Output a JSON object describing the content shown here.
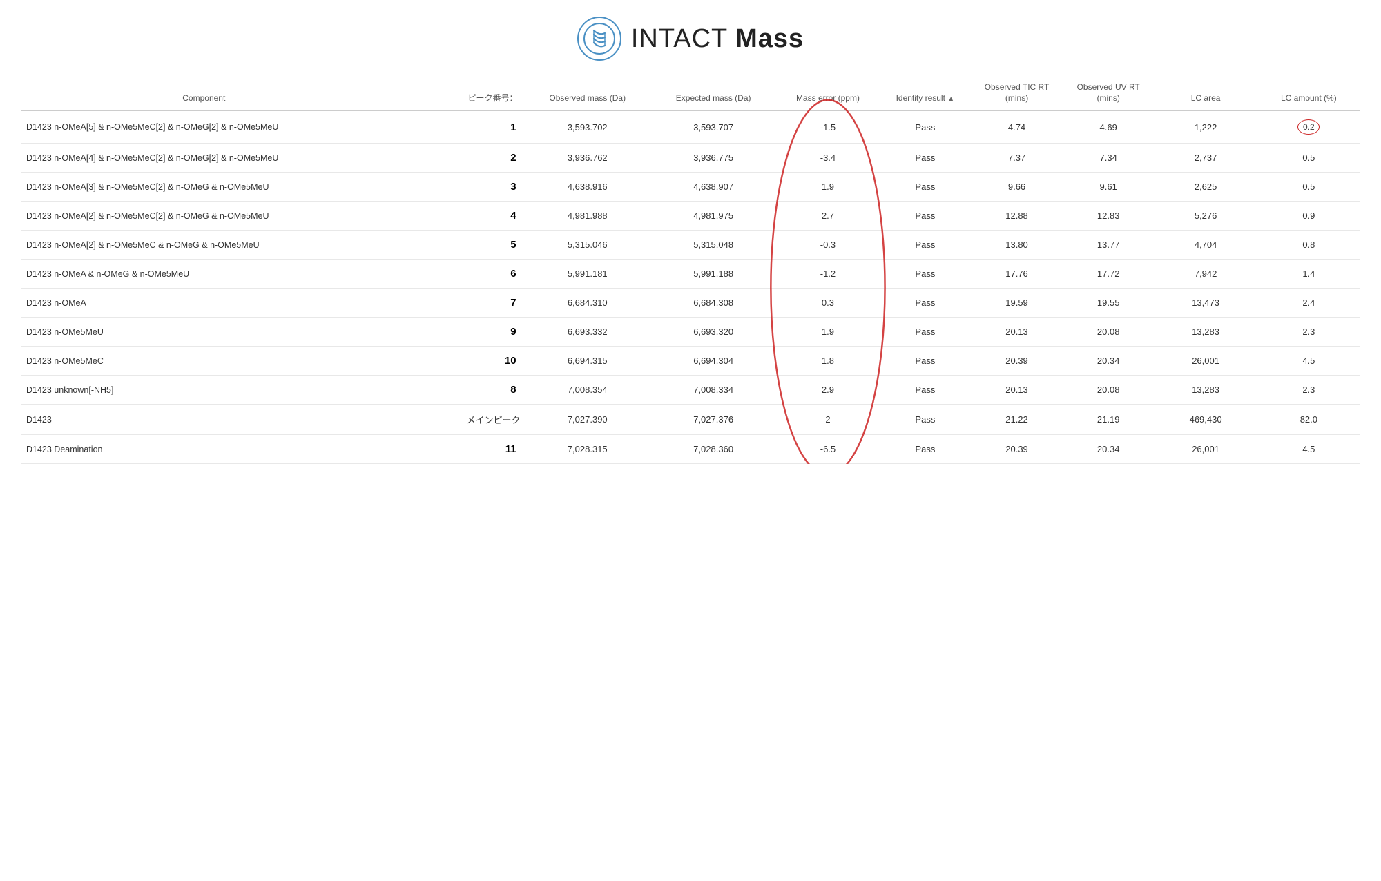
{
  "app": {
    "title_normal": "INTACT ",
    "title_bold": "Mass"
  },
  "table": {
    "headers": {
      "component": "Component",
      "peak_number": "ピーク番号：",
      "observed_mass": "Observed mass (Da)",
      "expected_mass": "Expected mass (Da)",
      "mass_error": "Mass error (ppm)",
      "identity_result": "Identity result",
      "observed_tic_rt": "Observed TIC RT (mins)",
      "observed_uv_rt": "Observed UV RT (mins)",
      "lc_area": "LC area",
      "lc_amount": "LC amount (%)"
    },
    "rows": [
      {
        "component": "D1423 n-OMeA[5] & n-OMe5MeC[2] & n-OMeG[2] & n-OMe5MeU",
        "peak_number": "1",
        "observed_mass": "3,593.702",
        "expected_mass": "3,593.707",
        "mass_error": "-1.5",
        "identity_result": "Pass",
        "observed_tic_rt": "4.74",
        "observed_uv_rt": "4.69",
        "lc_area": "1,222",
        "lc_amount": "0.2",
        "lc_amount_circled": true
      },
      {
        "component": "D1423 n-OMeA[4] & n-OMe5MeC[2] & n-OMeG[2] & n-OMe5MeU",
        "peak_number": "2",
        "observed_mass": "3,936.762",
        "expected_mass": "3,936.775",
        "mass_error": "-3.4",
        "identity_result": "Pass",
        "observed_tic_rt": "7.37",
        "observed_uv_rt": "7.34",
        "lc_area": "2,737",
        "lc_amount": "0.5",
        "lc_amount_circled": false
      },
      {
        "component": "D1423 n-OMeA[3] & n-OMe5MeC[2] & n-OMeG & n-OMe5MeU",
        "peak_number": "3",
        "observed_mass": "4,638.916",
        "expected_mass": "4,638.907",
        "mass_error": "1.9",
        "identity_result": "Pass",
        "observed_tic_rt": "9.66",
        "observed_uv_rt": "9.61",
        "lc_area": "2,625",
        "lc_amount": "0.5",
        "lc_amount_circled": false
      },
      {
        "component": "D1423 n-OMeA[2] & n-OMe5MeC[2] & n-OMeG & n-OMe5MeU",
        "peak_number": "4",
        "observed_mass": "4,981.988",
        "expected_mass": "4,981.975",
        "mass_error": "2.7",
        "identity_result": "Pass",
        "observed_tic_rt": "12.88",
        "observed_uv_rt": "12.83",
        "lc_area": "5,276",
        "lc_amount": "0.9",
        "lc_amount_circled": false
      },
      {
        "component": "D1423 n-OMeA[2] & n-OMe5MeC & n-OMeG & n-OMe5MeU",
        "peak_number": "5",
        "observed_mass": "5,315.046",
        "expected_mass": "5,315.048",
        "mass_error": "-0.3",
        "identity_result": "Pass",
        "observed_tic_rt": "13.80",
        "observed_uv_rt": "13.77",
        "lc_area": "4,704",
        "lc_amount": "0.8",
        "lc_amount_circled": false
      },
      {
        "component": "D1423 n-OMeA & n-OMeG & n-OMe5MeU",
        "peak_number": "6",
        "observed_mass": "5,991.181",
        "expected_mass": "5,991.188",
        "mass_error": "-1.2",
        "identity_result": "Pass",
        "observed_tic_rt": "17.76",
        "observed_uv_rt": "17.72",
        "lc_area": "7,942",
        "lc_amount": "1.4",
        "lc_amount_circled": false
      },
      {
        "component": "D1423 n-OMeA",
        "peak_number": "7",
        "observed_mass": "6,684.310",
        "expected_mass": "6,684.308",
        "mass_error": "0.3",
        "identity_result": "Pass",
        "observed_tic_rt": "19.59",
        "observed_uv_rt": "19.55",
        "lc_area": "13,473",
        "lc_amount": "2.4",
        "lc_amount_circled": false
      },
      {
        "component": "D1423 n-OMe5MeU",
        "peak_number": "9",
        "observed_mass": "6,693.332",
        "expected_mass": "6,693.320",
        "mass_error": "1.9",
        "identity_result": "Pass",
        "observed_tic_rt": "20.13",
        "observed_uv_rt": "20.08",
        "lc_area": "13,283",
        "lc_amount": "2.3",
        "lc_amount_circled": false
      },
      {
        "component": "D1423 n-OMe5MeC",
        "peak_number": "10",
        "observed_mass": "6,694.315",
        "expected_mass": "6,694.304",
        "mass_error": "1.8",
        "identity_result": "Pass",
        "observed_tic_rt": "20.39",
        "observed_uv_rt": "20.34",
        "lc_area": "26,001",
        "lc_amount": "4.5",
        "lc_amount_circled": false
      },
      {
        "component": "D1423 unknown[-NH5]",
        "peak_number": "8",
        "observed_mass": "7,008.354",
        "expected_mass": "7,008.334",
        "mass_error": "2.9",
        "identity_result": "Pass",
        "observed_tic_rt": "20.13",
        "observed_uv_rt": "20.08",
        "lc_area": "13,283",
        "lc_amount": "2.3",
        "lc_amount_circled": false
      },
      {
        "component": "D1423",
        "peak_number": "メインピーク",
        "is_main_peak": true,
        "observed_mass": "7,027.390",
        "expected_mass": "7,027.376",
        "mass_error": "2",
        "identity_result": "Pass",
        "observed_tic_rt": "21.22",
        "observed_uv_rt": "21.19",
        "lc_area": "469,430",
        "lc_amount": "82.0",
        "lc_amount_circled": false
      },
      {
        "component": "D1423 Deamination",
        "peak_number": "11",
        "observed_mass": "7,028.315",
        "expected_mass": "7,028.360",
        "mass_error": "-6.5",
        "identity_result": "Pass",
        "observed_tic_rt": "20.39",
        "observed_uv_rt": "20.34",
        "lc_area": "26,001",
        "lc_amount": "4.5",
        "lc_amount_circled": false
      }
    ]
  }
}
